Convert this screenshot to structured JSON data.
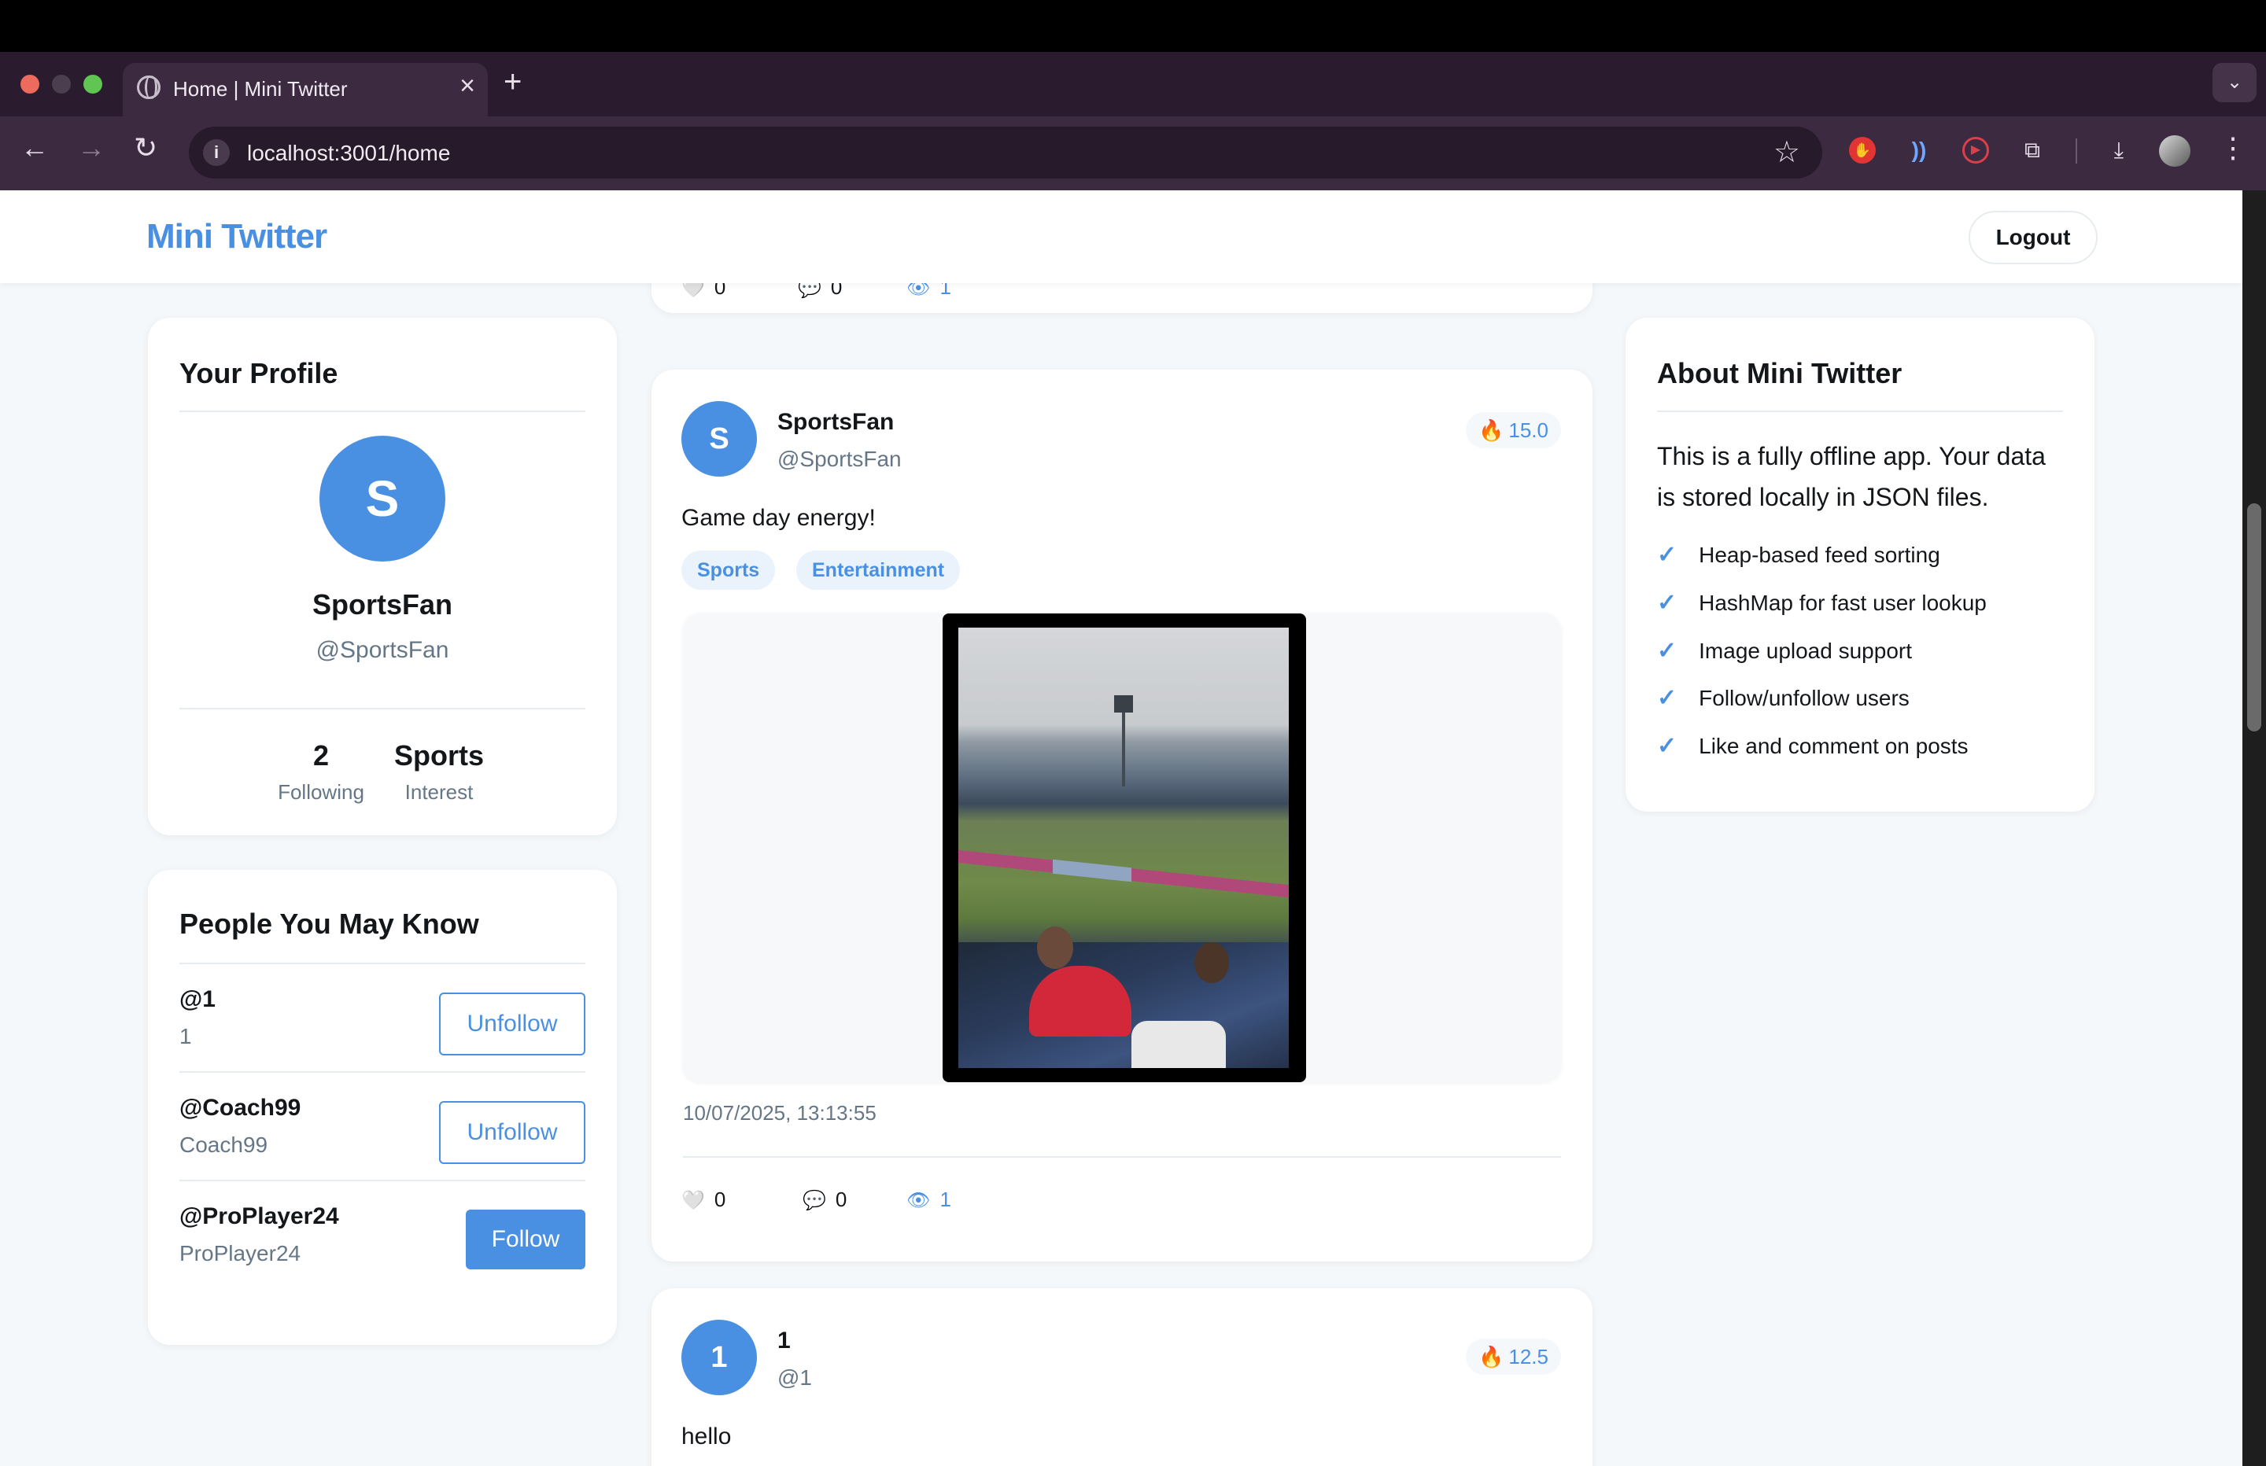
{
  "browser": {
    "tab_title": "Home | Mini Twitter",
    "tab_close": "×",
    "new_tab": "+",
    "url": "localhost:3001/home",
    "tab_menu_icon": "chevron-down"
  },
  "header": {
    "brand": "Mini Twitter",
    "logout_label": "Logout"
  },
  "profile": {
    "title": "Your Profile",
    "avatar_letter": "S",
    "name": "SportsFan",
    "handle": "@SportsFan",
    "stats": [
      {
        "value": "2",
        "label": "Following"
      },
      {
        "value": "Sports",
        "label": "Interest"
      }
    ]
  },
  "people": {
    "title": "People You May Know",
    "items": [
      {
        "handle": "@1",
        "name": "1",
        "button": "Unfollow"
      },
      {
        "handle": "@Coach99",
        "name": "Coach99",
        "button": "Unfollow"
      },
      {
        "handle": "@ProPlayer24",
        "name": "ProPlayer24",
        "button": "Follow"
      }
    ]
  },
  "about": {
    "title": "About Mini Twitter",
    "text": "This is a fully offline app. Your data is stored locally in JSON files.",
    "features": [
      "Heap-based feed sorting",
      "HashMap for fast user lookup",
      "Image upload support",
      "Follow/unfollow users",
      "Like and comment on posts"
    ]
  },
  "feed": {
    "prev_post": {
      "likes": "0",
      "comments": "0",
      "views": "1"
    },
    "main_post": {
      "avatar_letter": "S",
      "author": "SportsFan",
      "handle": "@SportsFan",
      "score": "15.0",
      "text": "Game day energy!",
      "tags": [
        "Sports",
        "Entertainment"
      ],
      "timestamp": "10/07/2025, 13:13:55",
      "likes": "0",
      "comments": "0",
      "views": "1"
    },
    "next_post": {
      "avatar_letter": "1",
      "author": "1",
      "handle": "@1",
      "score": "12.5",
      "text": "hello"
    }
  },
  "icons": {
    "heart": "🤍",
    "comment": "💬",
    "eye": "👁",
    "fire": "🔥",
    "check": "✓"
  },
  "colors": {
    "accent": "#4a90e2",
    "text": "#14171a",
    "muted": "#657786",
    "page_bg": "#f5f8fa"
  }
}
